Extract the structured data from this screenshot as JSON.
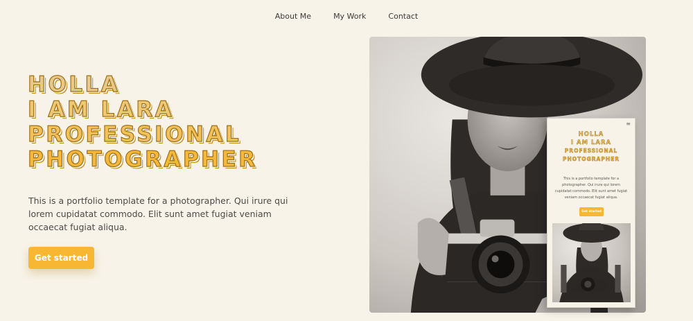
{
  "nav": {
    "items": [
      {
        "label": "About Me"
      },
      {
        "label": "My Work"
      },
      {
        "label": "Contact"
      }
    ]
  },
  "hero": {
    "title_lines": [
      "HOLLA",
      "I AM LARA",
      "PROFESSIONAL",
      "PHOTOGRAPHER"
    ],
    "description": "This is a portfolio template for a photographer. Qui irure qui lorem cupidatat commodo. Elit sunt amet fugiat veniam occaecat fugiat aliqua.",
    "cta_label": "Get started"
  },
  "mobile_preview": {
    "menu_icon": "hamburger-icon",
    "title_lines": [
      "HOLLA",
      "I AM LARA",
      "PROFESSIONAL",
      "PHOTOGRAPHER"
    ],
    "description": "This is a portfolio template for a photographer. Qui irure qui lorem cupidatat commodo. Elit sunt amet fugiat veniam occaecat fugiat aliqua.",
    "cta_label": "Get started"
  },
  "colors": {
    "background": "#f7f3e8",
    "accent": "#f7b733",
    "title_outline": "#a06f12",
    "text": "#4a4744"
  }
}
